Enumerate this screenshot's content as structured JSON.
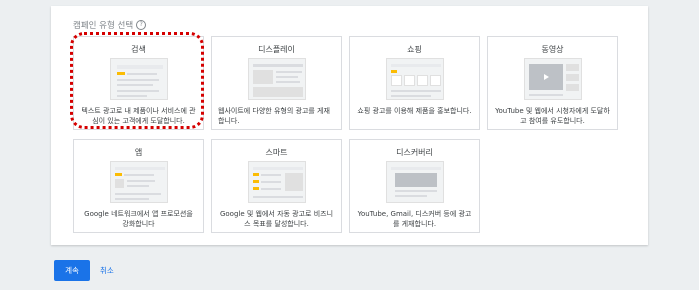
{
  "section": {
    "title": "캠페인 유형 선택",
    "help_icon": "help-circle-icon"
  },
  "cards": [
    {
      "title": "검색",
      "description": "텍스트 광고로 내 제품이나 서비스에 관심이 있는 고객에게 도달합니다.",
      "icon": "search-ad-illustration"
    },
    {
      "title": "디스플레이",
      "description": "웹사이트에 다양한 유형의 광고를 게재합니다.",
      "icon": "display-ad-illustration"
    },
    {
      "title": "쇼핑",
      "description": "쇼핑 광고를 이용해 제품을 홍보합니다.",
      "icon": "shopping-ad-illustration"
    },
    {
      "title": "동영상",
      "description": "YouTube 및 웹에서 시청자에게 도달하고 참여를 유도합니다.",
      "icon": "video-ad-illustration"
    },
    {
      "title": "앱",
      "description": "Google 네트워크에서 앱 프로모션을 강화합니다",
      "icon": "app-ad-illustration"
    },
    {
      "title": "스마트",
      "description": "Google 및 웹에서 자동 광고로 비즈니스 목표를 달성합니다.",
      "icon": "smart-ad-illustration"
    },
    {
      "title": "디스커버리",
      "description": "YouTube, Gmail, 디스커버 등에 광고를 게재합니다.",
      "icon": "discovery-ad-illustration"
    }
  ],
  "highlighted_card": "검색",
  "actions": {
    "continue_label": "계속",
    "cancel_label": "취소"
  },
  "colors": {
    "primary": "#1a73e8",
    "highlight": "#d50000",
    "accent_yellow": "#fbbc04"
  }
}
